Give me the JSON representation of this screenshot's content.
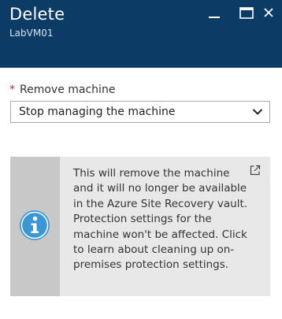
{
  "header": {
    "title": "Delete",
    "subtitle": "LabVM01",
    "background_color": "#0c3c66"
  },
  "window_controls": {
    "minimize_icon": "minimize-icon",
    "maximize_icon": "maximize-icon",
    "close_icon": "close-icon"
  },
  "form": {
    "required_marker": "*",
    "remove_machine_label": "Remove machine",
    "remove_machine_value": "Stop managing the machine",
    "dropdown_icon": "chevron-down-icon"
  },
  "info": {
    "text": "This will remove the machine and it will no longer be available in the Azure Site Recovery vault. Protection settings for the machine won't be affected. Click to learn about cleaning up on-premises protection settings.",
    "icon": "info-icon",
    "icon_color": "#3a97d4",
    "link_icon": "external-link-icon"
  }
}
